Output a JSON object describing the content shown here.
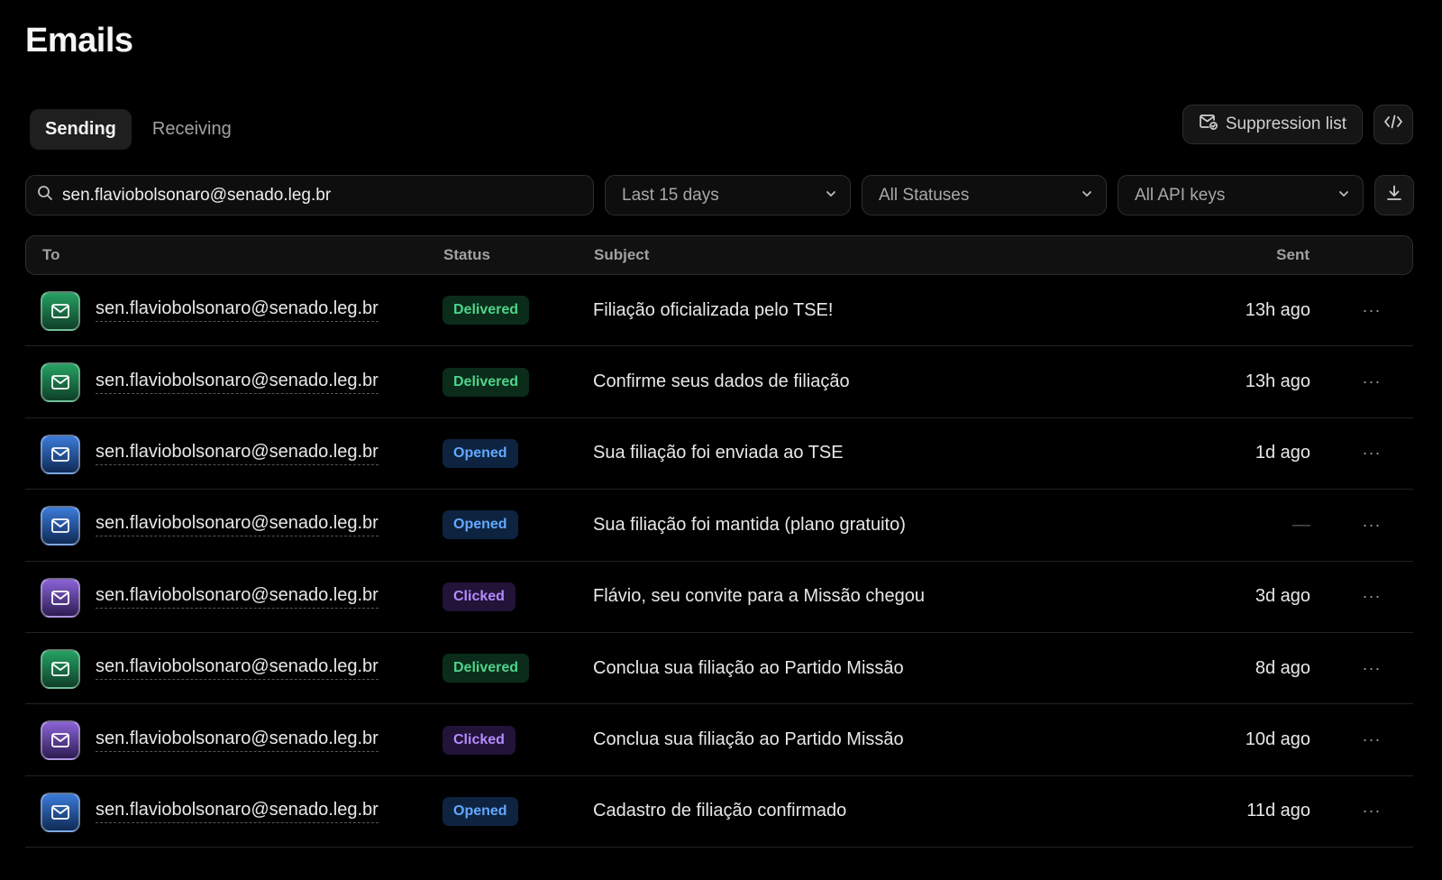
{
  "page": {
    "title": "Emails"
  },
  "tabs": [
    {
      "label": "Sending",
      "active": true
    },
    {
      "label": "Receiving",
      "active": false
    }
  ],
  "actions": {
    "suppression_label": "Suppression list",
    "suppression_icon": "mail-shield-icon",
    "code_icon": "code-icon"
  },
  "filters": {
    "search_value": "sen.flaviobolsonaro@senado.leg.br",
    "search_icon": "search-icon",
    "date_range": "Last 15 days",
    "status": "All Statuses",
    "api_keys": "All API keys",
    "download_icon": "download-icon"
  },
  "table": {
    "headers": {
      "to": "To",
      "status": "Status",
      "subject": "Subject",
      "sent": "Sent"
    },
    "rows": [
      {
        "to": "sen.flaviobolsonaro@senado.leg.br",
        "status": "Delivered",
        "subject": "Filiação oficializada pelo TSE!",
        "sent": "13h ago"
      },
      {
        "to": "sen.flaviobolsonaro@senado.leg.br",
        "status": "Delivered",
        "subject": "Confirme seus dados de filiação",
        "sent": "13h ago"
      },
      {
        "to": "sen.flaviobolsonaro@senado.leg.br",
        "status": "Opened",
        "subject": "Sua filiação foi enviada ao TSE",
        "sent": "1d ago"
      },
      {
        "to": "sen.flaviobolsonaro@senado.leg.br",
        "status": "Opened",
        "subject": "Sua filiação foi mantida (plano gratuito)",
        "sent": "—"
      },
      {
        "to": "sen.flaviobolsonaro@senado.leg.br",
        "status": "Clicked",
        "subject": "Flávio, seu convite para a Missão chegou",
        "sent": "3d ago"
      },
      {
        "to": "sen.flaviobolsonaro@senado.leg.br",
        "status": "Delivered",
        "subject": "Conclua sua filiação ao Partido Missão",
        "sent": "8d ago"
      },
      {
        "to": "sen.flaviobolsonaro@senado.leg.br",
        "status": "Clicked",
        "subject": "Conclua sua filiação ao Partido Missão",
        "sent": "10d ago"
      },
      {
        "to": "sen.flaviobolsonaro@senado.leg.br",
        "status": "Opened",
        "subject": "Cadastro de filiação confirmado",
        "sent": "11d ago"
      }
    ]
  },
  "colors": {
    "background": "#000000",
    "delivered": "#4fd38a",
    "opened": "#64a8ff",
    "clicked": "#b48bff"
  }
}
